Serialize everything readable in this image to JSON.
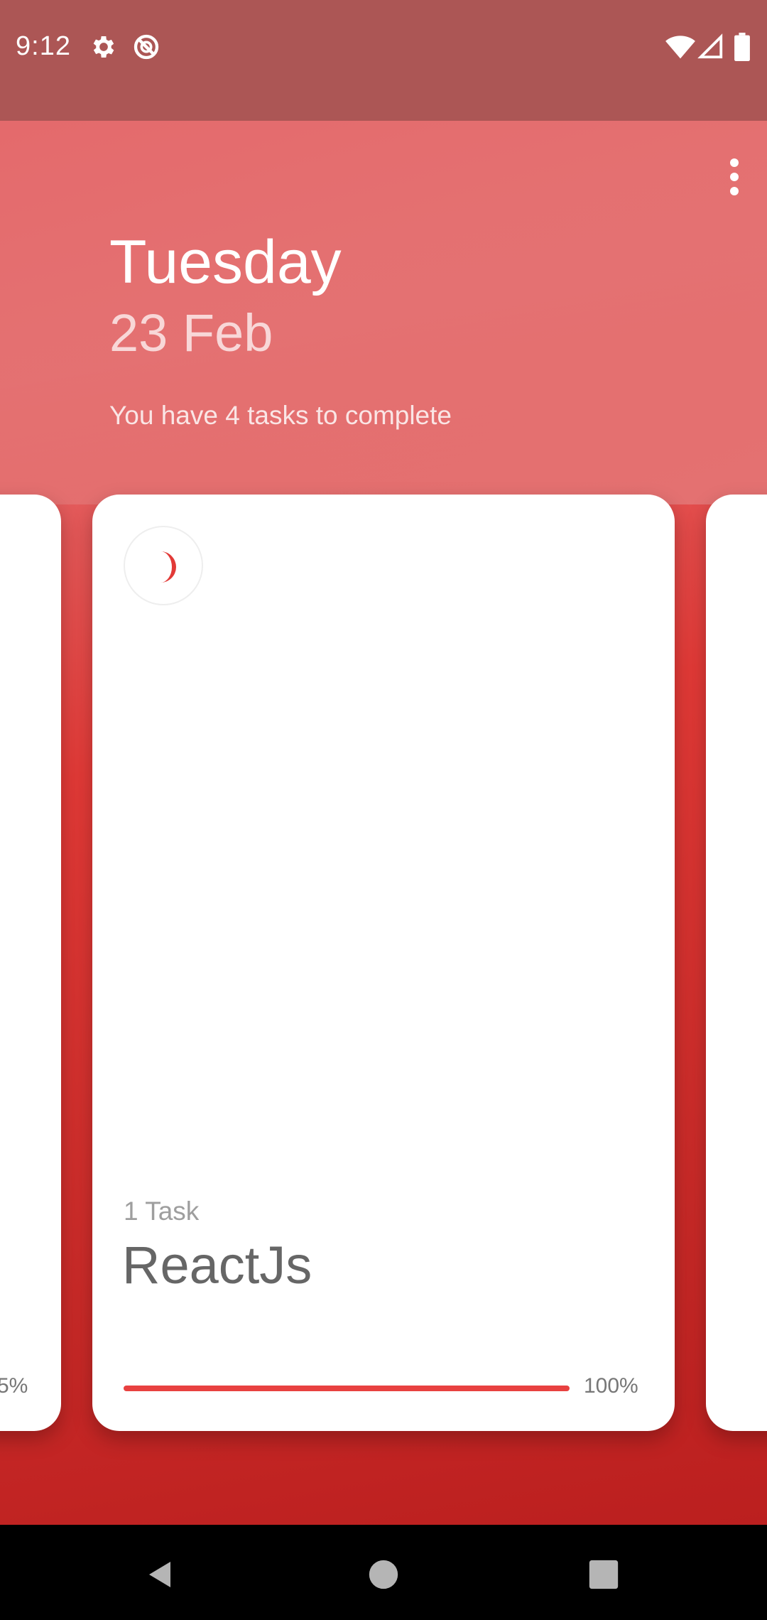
{
  "status_bar": {
    "time": "9:12",
    "left_icons": [
      "gear-icon",
      "no-disturb-icon"
    ],
    "right_icons": [
      "wifi-icon",
      "signal-icon",
      "battery-icon"
    ]
  },
  "header": {
    "day": "Tuesday",
    "date": "23 Feb",
    "subtitle": "You have 4 tasks to complete",
    "menu_icon": "more-vert-icon"
  },
  "cards": {
    "left": {
      "percent_label": "5%"
    },
    "main": {
      "icon": "crescent-moon-icon",
      "task_count": "1 Task",
      "title": "ReactJs",
      "progress": 1.0,
      "progress_label": "100%"
    }
  },
  "colors": {
    "status_bar": "#ac5655",
    "accent": "#e84140",
    "background_top": "#e46a6c",
    "background_bottom": "#b71c1c"
  },
  "nav_bar": {
    "buttons": [
      "back-icon",
      "home-icon",
      "recents-icon"
    ]
  }
}
